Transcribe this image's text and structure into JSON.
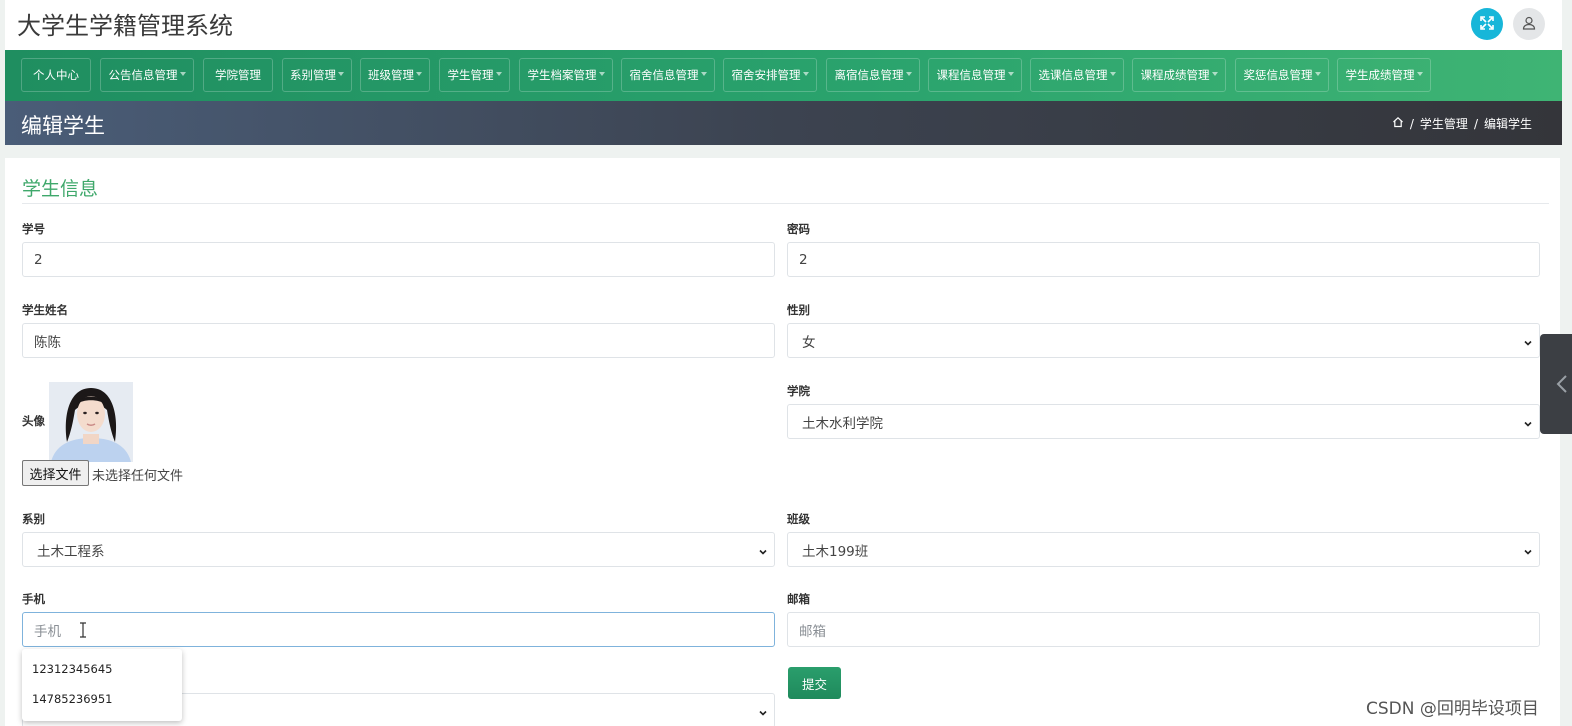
{
  "header": {
    "app_title": "大学生学籍管理系统"
  },
  "nav": {
    "items": [
      {
        "label": "个人中心",
        "dropdown": false
      },
      {
        "label": "公告信息管理",
        "dropdown": true
      },
      {
        "label": "学院管理",
        "dropdown": false
      },
      {
        "label": "系别管理",
        "dropdown": true
      },
      {
        "label": "班级管理",
        "dropdown": true
      },
      {
        "label": "学生管理",
        "dropdown": true
      },
      {
        "label": "学生档案管理",
        "dropdown": true
      },
      {
        "label": "宿舍信息管理",
        "dropdown": true
      },
      {
        "label": "宿舍安排管理",
        "dropdown": true
      },
      {
        "label": "离宿信息管理",
        "dropdown": true
      },
      {
        "label": "课程信息管理",
        "dropdown": true
      },
      {
        "label": "选课信息管理",
        "dropdown": true
      },
      {
        "label": "课程成绩管理",
        "dropdown": true
      },
      {
        "label": "奖惩信息管理",
        "dropdown": true
      },
      {
        "label": "学生成绩管理",
        "dropdown": true
      }
    ]
  },
  "page": {
    "title": "编辑学生",
    "breadcrumb": [
      "学生管理",
      "编辑学生"
    ],
    "breadcrumb_sep": "/"
  },
  "form": {
    "section_title": "学生信息",
    "student_no": {
      "label": "学号",
      "value": "2"
    },
    "password": {
      "label": "密码",
      "value": "2"
    },
    "name": {
      "label": "学生姓名",
      "value": "陈陈"
    },
    "gender": {
      "label": "性别",
      "value": "女"
    },
    "avatar": {
      "label": "头像",
      "file_button": "选择文件",
      "file_status": "未选择任何文件"
    },
    "college": {
      "label": "学院",
      "value": "土木水利学院"
    },
    "department": {
      "label": "系别",
      "value": "土木工程系"
    },
    "class": {
      "label": "班级",
      "value": "土木199班"
    },
    "phone": {
      "label": "手机",
      "placeholder": "手机"
    },
    "email": {
      "label": "邮箱",
      "placeholder": "邮箱"
    },
    "phone_suggestions": [
      "12312345645",
      "14785236951"
    ],
    "submit_label": "提交"
  },
  "watermark": "CSDN @回明毕设项目",
  "colors": {
    "nav_green": "#2aa36d",
    "accent_cyan": "#17b6d9",
    "section_title_green": "#3fa86b",
    "pagebar_dark": "#3c4350"
  },
  "icons": {
    "expand": "expand-icon",
    "user": "user-icon",
    "home": "home-icon",
    "chevron": "chevron-down-icon",
    "side": "chevron-left-icon"
  }
}
